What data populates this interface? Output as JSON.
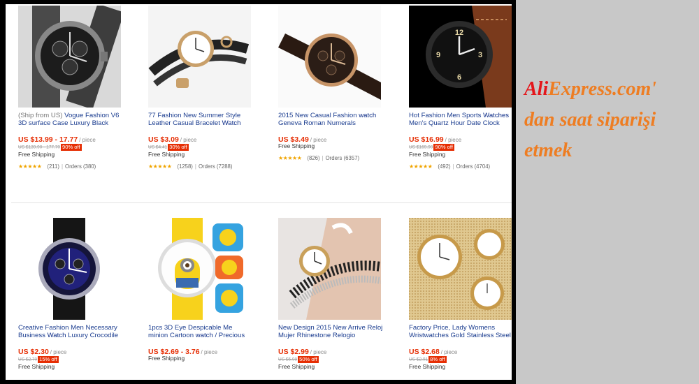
{
  "caption": {
    "brand_ali": "Ali",
    "brand_rest": "Express.com'",
    "line2": "dan saat siparişi",
    "line3": "etmek"
  },
  "colors": {
    "price": "#e62e04",
    "badge": "#e62e04",
    "caption_orange": "#ee7d22",
    "caption_red": "#e4161b",
    "stars": "#f0a400"
  },
  "products": [
    {
      "title_pre": "(Ship from US)",
      "title_mid": " Vogue Fashion V6 3D surface Case Luxury Black",
      "title_kw": "",
      "title_post": "",
      "price": "US $13.99 - 17.77",
      "unit": "/ piece",
      "old_price": "US $139.90 - 177.70",
      "discount": "90% off",
      "shipping": "Free Shipping",
      "stars": "★★★★★",
      "reviews": "(211)",
      "orders": "Orders (380)"
    },
    {
      "title_pre": "",
      "title_mid": "77 Fashion New Summer Style Leather Casual Bracelet ",
      "title_kw": "Watch",
      "title_post": "",
      "price": "US $3.09",
      "unit": "/ piece",
      "old_price": "US $4.41",
      "discount": "30% off",
      "shipping": "Free Shipping",
      "stars": "★★★★★",
      "reviews": "(1258)",
      "orders": "Orders (7288)"
    },
    {
      "title_pre": "",
      "title_mid": "2015 New Casual Fashion ",
      "title_kw": "watch",
      "title_post": " Geneva Roman Numerals",
      "price": "US $3.49",
      "unit": "/ piece",
      "old_price": "",
      "discount": "",
      "shipping": "Free Shipping",
      "stars": "★★★★★",
      "reviews": "(826)",
      "orders": "Orders (6357)"
    },
    {
      "title_pre": "",
      "title_mid": "Hot Fashion Men Sports ",
      "title_kw": "Watches",
      "title_post": " Men's Quartz Hour Date Clock",
      "price": "US $16.99",
      "unit": "/ piece",
      "old_price": "US $169.90",
      "discount": "90% off",
      "shipping": "Free Shipping",
      "stars": "★★★★★",
      "reviews": "(492)",
      "orders": "Orders (4704)"
    },
    {
      "title_pre": "",
      "title_mid": "Creative Fashion Men Necessary Business ",
      "title_kw": "Watch",
      "title_post": " Luxury Crocodile",
      "price": "US $2.30",
      "unit": "/ piece",
      "old_price": "US $2.70",
      "discount": "15% off",
      "shipping": "Free Shipping",
      "stars": "",
      "reviews": "",
      "orders": ""
    },
    {
      "title_pre": "",
      "title_mid": "1pcs 3D Eye Despicable Me minion Cartoon ",
      "title_kw": "watch",
      "title_post": " / Precious",
      "price": "US $2.69 - 3.76",
      "unit": "/ piece",
      "old_price": "",
      "discount": "",
      "shipping": "Free Shipping",
      "stars": "",
      "reviews": "",
      "orders": ""
    },
    {
      "title_pre": "",
      "title_mid": "New Design 2015 New Arrive Reloj Mujer Rhinestone Relogio",
      "title_kw": "",
      "title_post": "",
      "price": "US $2.99",
      "unit": "/ piece",
      "old_price": "US $5.98",
      "discount": "50% off",
      "shipping": "Free Shipping",
      "stars": "",
      "reviews": "",
      "orders": ""
    },
    {
      "title_pre": "",
      "title_mid": "Factory Price, Lady Womens Wristwatches Gold Stainless Steel",
      "title_kw": "",
      "title_post": "",
      "price": "US $2.68",
      "unit": "/ piece",
      "old_price": "US $2.91",
      "discount": "8% off",
      "shipping": "Free Shipping",
      "stars": "",
      "reviews": "",
      "orders": ""
    }
  ]
}
